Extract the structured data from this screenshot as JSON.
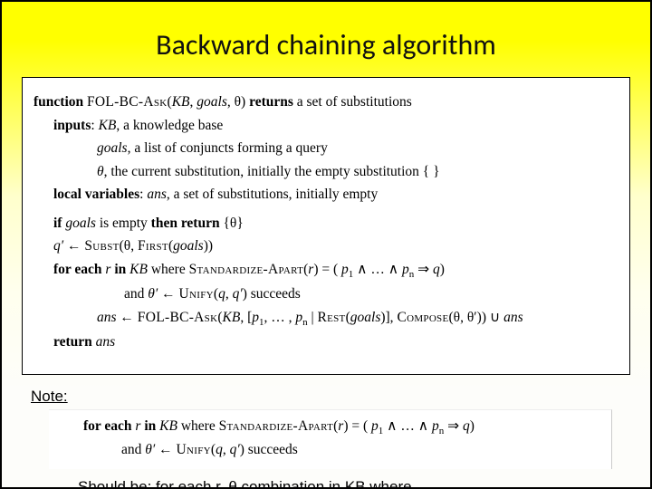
{
  "title": "Backward chaining algorithm",
  "algo": {
    "l1a": "function",
    "l1b": "FOL-BC-Ask",
    "l1c": "KB",
    "l1d": "goals",
    "l1e": "returns",
    "l1f": "a set of substitutions",
    "l2a": "inputs",
    "l2b": "KB",
    "l2c": ", a knowledge base",
    "l3a": "goals",
    "l3b": ", a list of conjuncts forming a query",
    "l4a": "θ",
    "l4b": ", the current substitution, initially the empty substitution { }",
    "l5a": "local variables",
    "l5b": "ans",
    "l5c": ", a set of substitutions, initially empty",
    "l6a": "if",
    "l6b": "goals",
    "l6c": "is empty",
    "l6d": "then return",
    "l6e": "{θ}",
    "l7a": "q′",
    "l7b": " ← ",
    "l7c": "Subst",
    "l7d": "(θ, ",
    "l7e": "First",
    "l7f": "(",
    "l7g": "goals",
    "l7h": "))",
    "l8a": "for each",
    "l8b": "r",
    "l8c": "in",
    "l8d": "KB",
    "l8e": "where",
    "l8f": "Standardize-Apart",
    "l8g": "(",
    "l8h": "r",
    "l8i": ") = ( ",
    "l8j": "p",
    "l8k": "1",
    "l8l": " ∧  …  ∧ ",
    "l8m": "p",
    "l8n": "n",
    "l8o": "  ⇒  ",
    "l8p": "q",
    "l8q": ")",
    "l9a": "and ",
    "l9b": "θ′",
    "l9c": " ← ",
    "l9d": "Unify",
    "l9e": "(",
    "l9f": "q",
    "l9g": ", ",
    "l9h": "q′",
    "l9i": ") succeeds",
    "l10a": "ans",
    "l10b": " ← ",
    "l10c": "FOL-BC-Ask",
    "l10d": "(",
    "l10e": "KB",
    "l10f": ", [",
    "l10g": "p",
    "l10h": "1",
    "l10i": ", … , ",
    "l10j": "p",
    "l10k": "n",
    "l10l": " | ",
    "l10m": "Rest",
    "l10n": "(",
    "l10o": "goals",
    "l10p": ")], ",
    "l10q": "Compose",
    "l10r": "(θ, θ′))  ∪  ",
    "l10s": "ans",
    "l11a": "return",
    "l11b": "ans"
  },
  "note": {
    "label": "Note:",
    "l1a": "for each",
    "l1b": "r",
    "l1c": "in",
    "l1d": "KB",
    "l1e": "where",
    "l1f": "Standardize-Apart",
    "l1g": "(",
    "l1h": "r",
    "l1i": ") = ( ",
    "l1j": "p",
    "l1k": "1",
    "l1l": "  ∧   …   ∧  ",
    "l1m": "p",
    "l1n": "n",
    "l1o": "   ⇒   ",
    "l1p": "q",
    "l1q": ")",
    "l2a": "and ",
    "l2b": "θ′",
    "l2c": " ← ",
    "l2d": "Unify",
    "l2e": "(",
    "l2f": "q",
    "l2g": ", ",
    "l2h": "q′",
    "l2i": ") succeeds",
    "should": "Should be: for each r, θ combination in KB where . . . ."
  }
}
